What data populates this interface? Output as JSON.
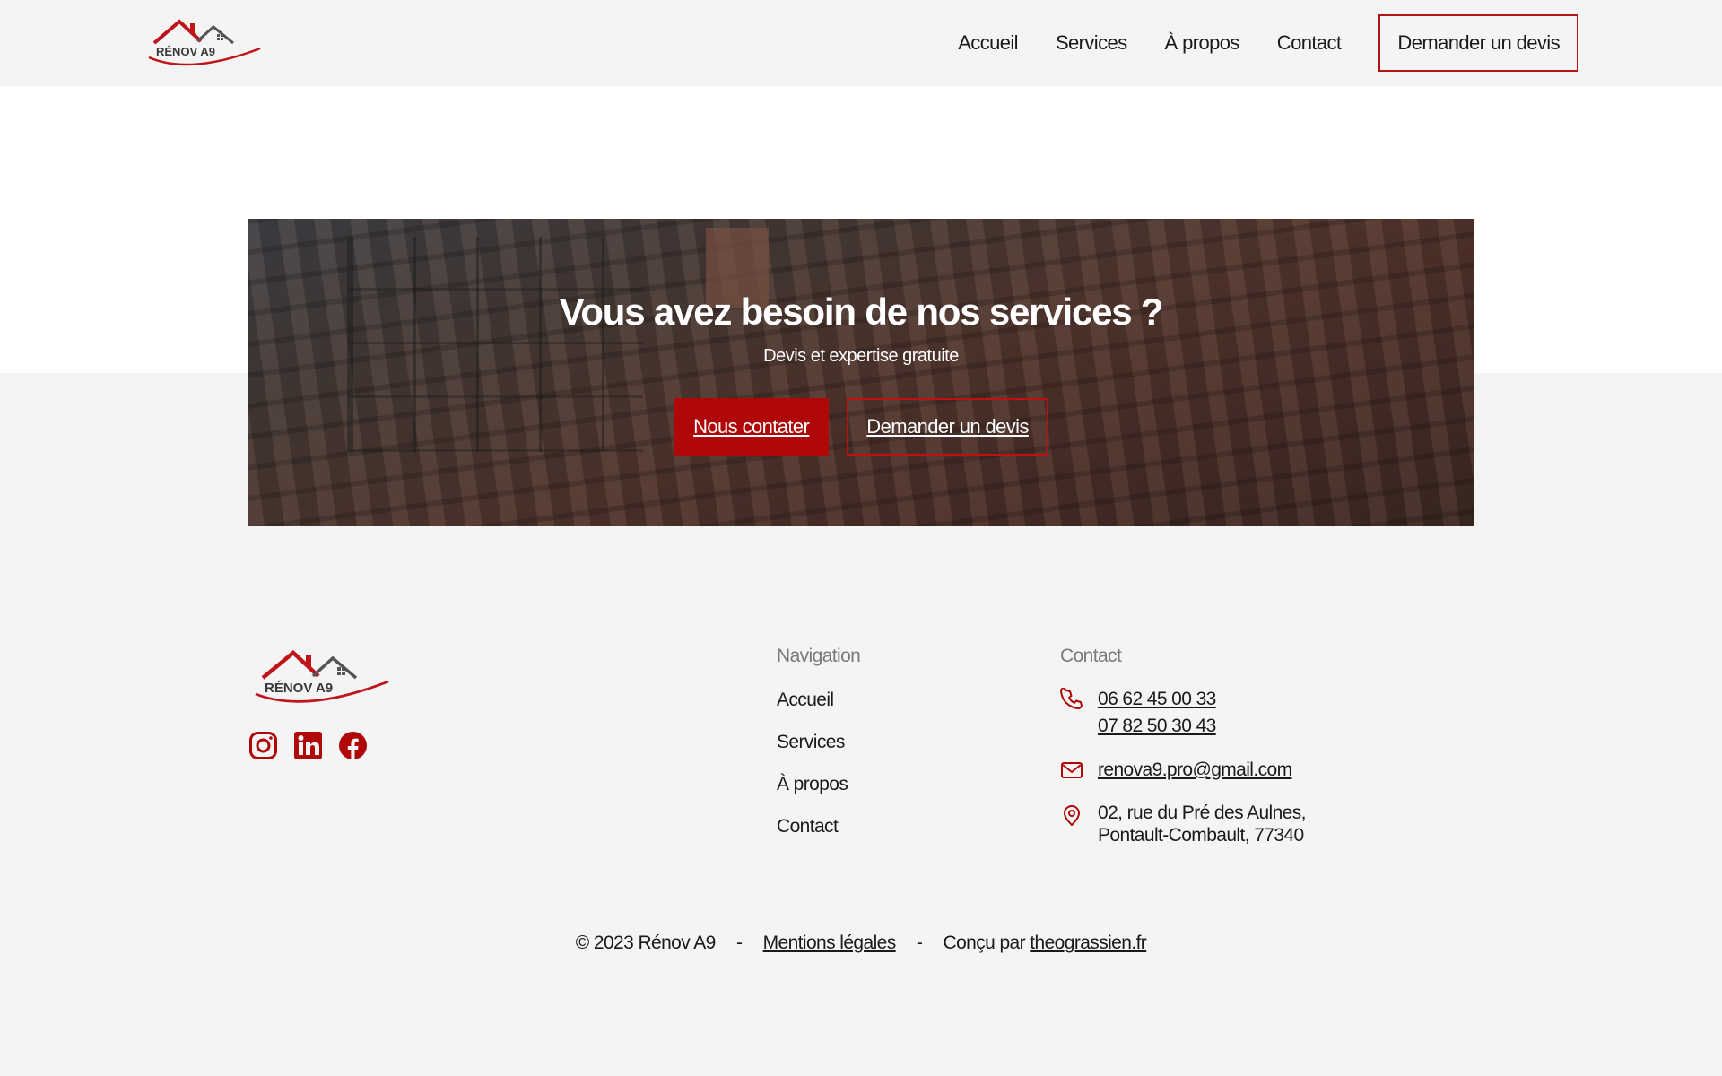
{
  "brand": {
    "logo_text": "RÉNOV A9",
    "accent_color": "#b00808"
  },
  "header": {
    "nav": [
      "Accueil",
      "Services",
      "À propos",
      "Contact"
    ],
    "cta_label": "Demander un devis"
  },
  "cta": {
    "title": "Vous avez besoin de nos services ?",
    "subtitle": "Devis et expertise gratuite",
    "primary_label": "Nous contater",
    "secondary_label": "Demander un devis"
  },
  "footer": {
    "socials": [
      "instagram-icon",
      "linkedin-icon",
      "facebook-icon"
    ],
    "navigation_title": "Navigation",
    "navigation": [
      "Accueil",
      "Services",
      "À propos",
      "Contact"
    ],
    "contact_title": "Contact",
    "phones": [
      "06 62 45 00 33",
      "07 82 50 30 43"
    ],
    "email": "renova9.pro@gmail.com",
    "address_line1": "02, rue du Pré des Aulnes,",
    "address_line2": "Pontault-Combault, 77340",
    "copyright": "© 2023 Rénov A9",
    "separator": "-",
    "legal_link": "Mentions légales",
    "designed_by_prefix": "Conçu par",
    "designed_by_link": "theograssien.fr"
  }
}
